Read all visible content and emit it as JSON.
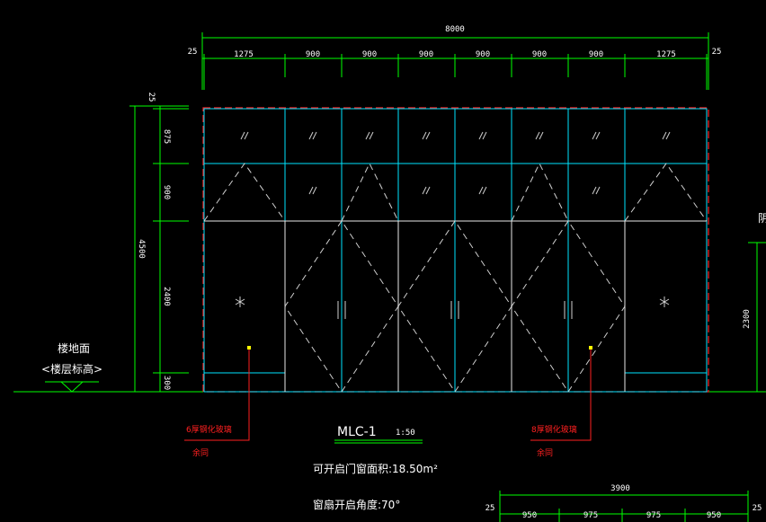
{
  "drawing": {
    "title": "MLC-1",
    "scale": "1:50",
    "area_text": "可开启门窗面积:18.50m²",
    "angle_text": "窗扇开启角度:70°"
  },
  "dimensions": {
    "top_total": "8000",
    "top_edge_left": "25",
    "top_edge_right": "25",
    "top_segments": [
      "1275",
      "900",
      "900",
      "900",
      "900",
      "900",
      "900",
      "1275"
    ],
    "left_top": "25",
    "left_segments": [
      "875",
      "900",
      "2400",
      "300"
    ],
    "left_total": "4500",
    "right_height": "2300",
    "bottom_total": "3900",
    "bottom_edge_left": "25",
    "bottom_edge_right": "25",
    "bottom_segments": [
      "950",
      "975",
      "975",
      "950"
    ]
  },
  "floor": {
    "label": "楼地面",
    "sublabel": "<楼层标高>"
  },
  "notes": {
    "left_line1": "6厚钢化玻璃",
    "left_line2": "余同",
    "right_line1": "8厚钢化玻璃",
    "right_line2": "余同"
  },
  "edge_glyph": "阴",
  "colors": {
    "background": "#000000",
    "frame": "#00e5ff",
    "dimension": "#00ff00",
    "outline": "#ff2020",
    "text": "#ffffff"
  }
}
